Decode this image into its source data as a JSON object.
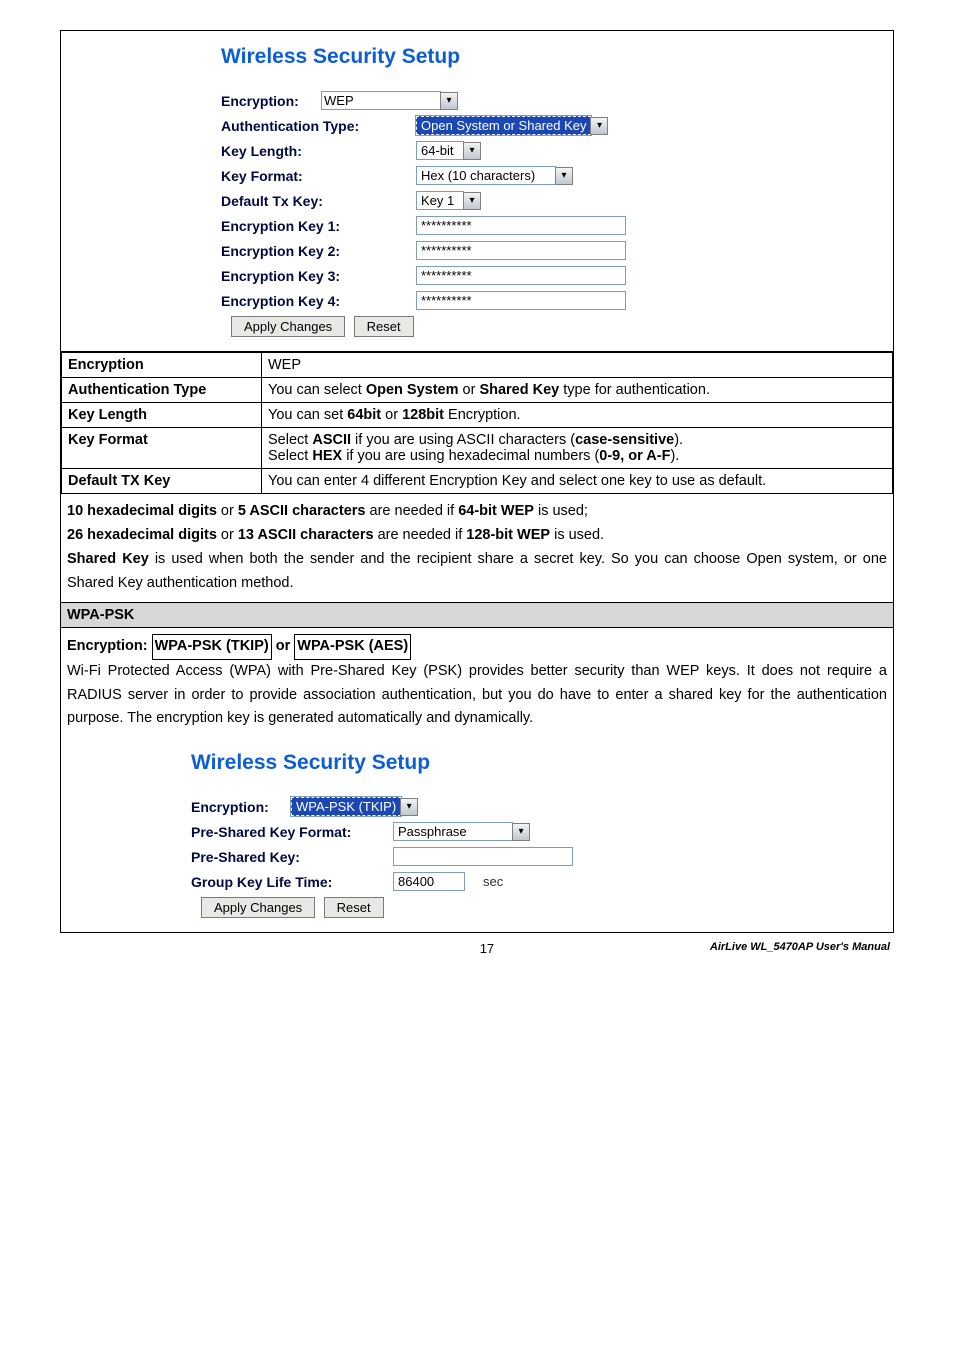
{
  "panel1": {
    "title": "Wireless Security Setup",
    "encryption_label": "Encryption:",
    "encryption_value": "WEP",
    "auth_label": "Authentication Type:",
    "auth_value": "Open System or Shared Key",
    "keylen_label": "Key Length:",
    "keylen_value": "64-bit",
    "keyfmt_label": "Key Format:",
    "keyfmt_value": "Hex (10 characters)",
    "deftx_label": "Default Tx Key:",
    "deftx_value": "Key 1",
    "ek1_label": "Encryption Key 1:",
    "ek2_label": "Encryption Key 2:",
    "ek3_label": "Encryption Key 3:",
    "ek4_label": "Encryption Key 4:",
    "ek_value": "**********",
    "apply_label": "Apply Changes",
    "reset_label": "Reset"
  },
  "table": {
    "r1c1": "Encryption",
    "r1c2": "WEP",
    "r2c1": "Authentication Type",
    "r2c2_a": "You can select ",
    "r2c2_b": "Open System",
    "r2c2_c": " or ",
    "r2c2_d": "Shared Key",
    "r2c2_e": " type for authentication.",
    "r3c1": "Key Length",
    "r3c2_a": "You can set ",
    "r3c2_b": "64bit",
    "r3c2_c": " or ",
    "r3c2_d": "128bit",
    "r3c2_e": " Encryption.",
    "r4c1": "Key Format",
    "r4c2_a": "Select ",
    "r4c2_b": "ASCII",
    "r4c2_c": " if you are using ASCII characters (",
    "r4c2_d": "case-sensitive",
    "r4c2_e": ").",
    "r4c2_f": "Select ",
    "r4c2_g": "HEX",
    "r4c2_h": " if you are using hexadecimal numbers (",
    "r4c2_i": "0-9, or A-F",
    "r4c2_j": ").",
    "r5c1": "Default TX Key",
    "r5c2": "You can enter 4 different Encryption Key and select one key to use as default."
  },
  "para": {
    "l1a": "10 hexadecimal digits",
    "l1b": " or ",
    "l1c": "5 ASCII characters",
    "l1d": " are needed if ",
    "l1e": "64-bit WEP",
    "l1f": " is used;",
    "l2a": "26 hexadecimal digits",
    "l2b": " or ",
    "l2c": "13 ASCII characters",
    "l2d": " are needed if ",
    "l2e": "128-bit WEP",
    "l2f": " is used.",
    "l3a": "Shared Key",
    "l3b": " is used when both the sender and the recipient share a secret key. So you can choose Open system, or one Shared Key authentication method."
  },
  "wpa_header": "WPA-PSK",
  "wpa_intro": {
    "a": "Encryption: ",
    "b": "WPA-PSK (TKIP)",
    "c": " or ",
    "d": "WPA-PSK (AES)",
    "body": "Wi-Fi Protected Access (WPA) with Pre-Shared Key (PSK) provides better security than WEP keys. It does not require a RADIUS server in order to provide association authentication, but you do have to enter a shared key for the authentication purpose. The encryption key is generated automatically and dynamically."
  },
  "panel2": {
    "title": "Wireless Security Setup",
    "encryption_label": "Encryption:",
    "encryption_value": "WPA-PSK (TKIP)",
    "psk_fmt_label": "Pre-Shared Key Format:",
    "psk_fmt_value": "Passphrase",
    "psk_label": "Pre-Shared Key:",
    "gkl_label": "Group Key Life Time:",
    "gkl_value": "86400",
    "gkl_unit": "sec",
    "apply_label": "Apply Changes",
    "reset_label": "Reset"
  },
  "footer": {
    "page": "17",
    "manual": "AirLive WL_5470AP User's Manual"
  }
}
